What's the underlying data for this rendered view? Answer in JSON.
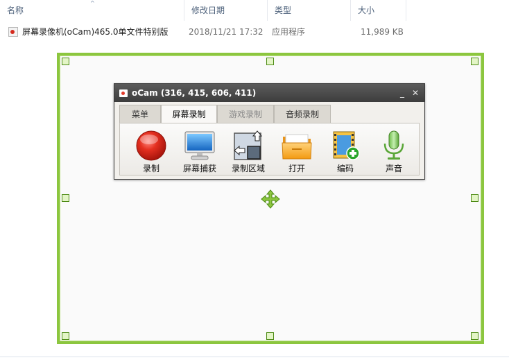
{
  "explorer": {
    "columns": [
      "名称",
      "修改日期",
      "类型",
      "大小"
    ],
    "sort_indicator": "^",
    "files": [
      {
        "name": "屏幕录像机(oCam)465.0单文件特别版",
        "modified": "2018/11/21 17:32",
        "type": "应用程序",
        "size": "11,989 KB",
        "icon": "ocam-app-icon"
      }
    ]
  },
  "recording_region": {
    "border_color": "#8cc63f",
    "move_icon": "move-arrows-icon"
  },
  "ocam_window": {
    "title": "oCam (316, 415, 606, 411)",
    "minimize_label": "_",
    "close_label": "✕",
    "tabs": [
      {
        "label": "菜单",
        "state": "normal"
      },
      {
        "label": "屏幕录制",
        "state": "active"
      },
      {
        "label": "游戏录制",
        "state": "disabled"
      },
      {
        "label": "音频录制",
        "state": "normal"
      }
    ],
    "tools": [
      {
        "label": "录制",
        "icon": "record-icon"
      },
      {
        "label": "屏幕捕获",
        "icon": "monitor-icon"
      },
      {
        "label": "录制区域",
        "icon": "resize-area-icon"
      },
      {
        "label": "打开",
        "icon": "folder-icon"
      },
      {
        "label": "编码",
        "icon": "film-add-icon"
      },
      {
        "label": "声音",
        "icon": "microphone-icon"
      }
    ]
  }
}
